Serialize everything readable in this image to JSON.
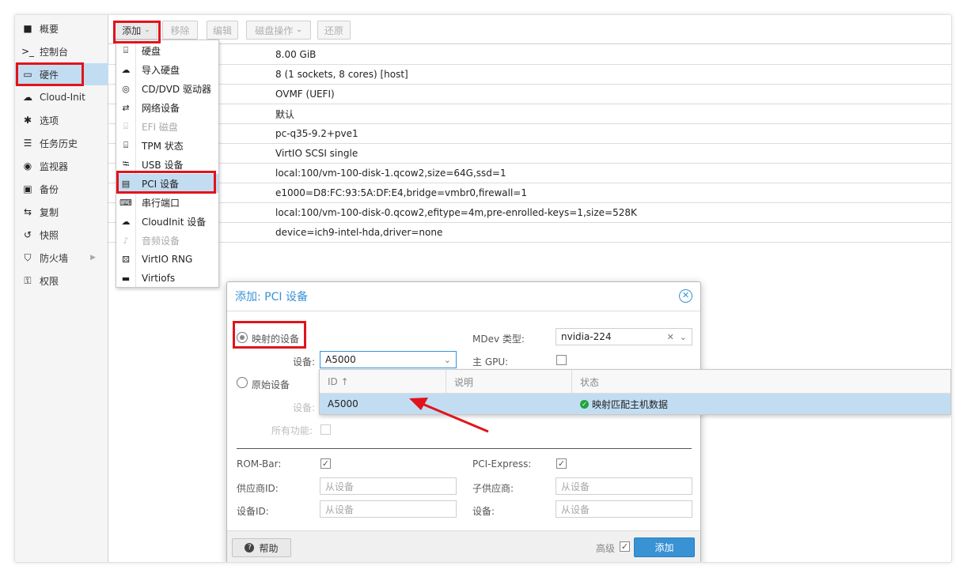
{
  "sidebar": {
    "items": [
      {
        "icon": "book-icon",
        "glyph": "■",
        "label": "概要"
      },
      {
        "icon": "terminal-icon",
        "glyph": ">_",
        "label": "控制台"
      },
      {
        "icon": "monitor-icon",
        "glyph": "▭",
        "label": "硬件"
      },
      {
        "icon": "cloud-icon",
        "glyph": "☁",
        "label": "Cloud-Init"
      },
      {
        "icon": "gear-icon",
        "glyph": "✱",
        "label": "选项"
      },
      {
        "icon": "list-icon",
        "glyph": "☰",
        "label": "任务历史"
      },
      {
        "icon": "eye-icon",
        "glyph": "◉",
        "label": "监视器"
      },
      {
        "icon": "floppy-icon",
        "glyph": "▣",
        "label": "备份"
      },
      {
        "icon": "retweet-icon",
        "glyph": "⇆",
        "label": "复制"
      },
      {
        "icon": "history-icon",
        "glyph": "↺",
        "label": "快照"
      },
      {
        "icon": "shield-icon",
        "glyph": "⛉",
        "label": "防火墙"
      },
      {
        "icon": "unlock-icon",
        "glyph": "⚿",
        "label": "权限"
      }
    ]
  },
  "toolbar": {
    "add": "添加",
    "remove": "移除",
    "edit": "编辑",
    "disk_action": "磁盘操作",
    "revert": "还原"
  },
  "rows": [
    "8.00 GiB",
    "8 (1 sockets, 8 cores) [host]",
    "OVMF (UEFI)",
    "默认",
    "pc-q35-9.2+pve1",
    "VirtIO SCSI single",
    "local:100/vm-100-disk-1.qcow2,size=64G,ssd=1",
    "e1000=D8:FC:93:5A:DF:E4,bridge=vmbr0,firewall=1",
    "local:100/vm-100-disk-0.qcow2,efitype=4m,pre-enrolled-keys=1,size=528K",
    "device=ich9-intel-hda,driver=none"
  ],
  "add_menu": {
    "items": [
      {
        "icon": "hdd-icon",
        "glyph": "⌸",
        "label": "硬盘",
        "disabled": false
      },
      {
        "icon": "cloud-download-icon",
        "glyph": "☁",
        "label": "导入硬盘",
        "disabled": false
      },
      {
        "icon": "cdrom-icon",
        "glyph": "◎",
        "label": "CD/DVD 驱动器",
        "disabled": false
      },
      {
        "icon": "exchange-icon",
        "glyph": "⇄",
        "label": "网络设备",
        "disabled": false
      },
      {
        "icon": "hdd-icon",
        "glyph": "⌸",
        "label": "EFI 磁盘",
        "disabled": true
      },
      {
        "icon": "hdd-icon",
        "glyph": "⌸",
        "label": "TPM 状态",
        "disabled": false
      },
      {
        "icon": "usb-icon",
        "glyph": "⭾",
        "label": "USB 设备",
        "disabled": false
      },
      {
        "icon": "pci-card-icon",
        "glyph": "▤",
        "label": "PCI 设备",
        "disabled": false
      },
      {
        "icon": "keyboard-icon",
        "glyph": "⌨",
        "label": "串行端口",
        "disabled": false
      },
      {
        "icon": "cloud-icon",
        "glyph": "☁",
        "label": "CloudInit 设备",
        "disabled": false
      },
      {
        "icon": "volume-icon",
        "glyph": "♪",
        "label": "音频设备",
        "disabled": true
      },
      {
        "icon": "dice-icon",
        "glyph": "⚄",
        "label": "VirtIO RNG",
        "disabled": false
      },
      {
        "icon": "folder-icon",
        "glyph": "▬",
        "label": "Virtiofs",
        "disabled": false
      }
    ]
  },
  "dialog": {
    "title": "添加: PCI 设备",
    "mapped_label": "映射的设备",
    "raw_label": "原始设备",
    "device_label": "设备:",
    "device_value": "A5000",
    "raw_device_label": "设备:",
    "all_functions_label": "所有功能:",
    "mdev_label": "MDev 类型:",
    "mdev_value": "nvidia-224",
    "primary_gpu_label": "主 GPU:",
    "rombar_label": "ROM-Bar:",
    "pcie_label": "PCI-Express:",
    "vendor_id_label": "供应商ID:",
    "vendor_id_placeholder": "从设备",
    "subvendor_label": "子供应商:",
    "subvendor_placeholder": "从设备",
    "device_id_label": "设备ID:",
    "device_id_placeholder": "从设备",
    "subdevice_label": "设备:",
    "subdevice_placeholder": "从设备",
    "help_button": "帮助",
    "advanced_label": "高级",
    "add_button": "添加"
  },
  "device_list": {
    "columns": [
      "ID ↑",
      "说明",
      "状态"
    ],
    "rows": [
      {
        "id": "A5000",
        "desc": "",
        "status": "映射匹配主机数据"
      }
    ]
  },
  "colors": {
    "accent": "#3892d4",
    "highlight": "#c2ddf2",
    "annotation": "#e1141c",
    "ok": "#21a33d"
  }
}
